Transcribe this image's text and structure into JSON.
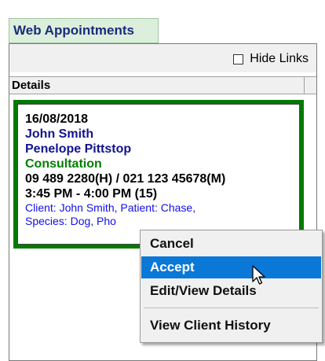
{
  "tab": {
    "label": "Web Appointments"
  },
  "toolbar": {
    "hide_links_label": "Hide Links",
    "hide_links_checked": false
  },
  "list": {
    "column_header": "Details"
  },
  "appointment": {
    "date": "16/08/2018",
    "client_name": "John Smith",
    "patient_name": "Penelope Pittstop",
    "type": "Consultation",
    "phone": "09 489 2280(H) / 021 123 45678(M)",
    "time": "3:45 PM - 4:00 PM (15)",
    "note_line1": "Client: John Smith, Patient: Chase,",
    "note_line2": "Species: Dog, Pho"
  },
  "context_menu": {
    "items": [
      {
        "label": "Cancel"
      },
      {
        "label": "Accept"
      },
      {
        "label": "Edit/View Details"
      },
      {
        "label": "View Client History"
      }
    ],
    "highlighted": "Accept"
  },
  "colors": {
    "tab_bg": "#dcefdc",
    "card_border": "#007a00",
    "client_text": "#13138f",
    "type_text": "#008000",
    "note_text": "#1010e8",
    "menu_highlight": "#0a78d7"
  },
  "icons": {
    "cursor": "arrow-cursor-icon"
  }
}
